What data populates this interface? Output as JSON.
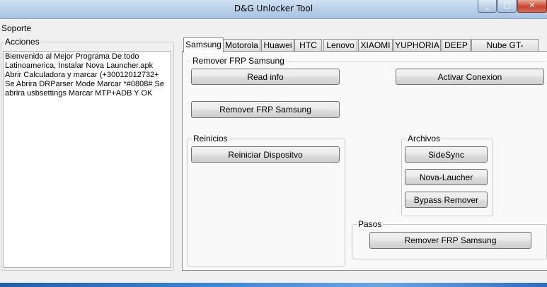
{
  "window": {
    "title": "D&G Unlocker Tool",
    "minimize": "_",
    "maximize": "□",
    "close": "✕"
  },
  "menu": {
    "items": [
      "Soporte"
    ]
  },
  "actions": {
    "label": "Acciones",
    "text": "Bienvenido al Mejor Programa De todo Latinoamerica, Instalar Nova Launcher.apk  Abrir Calculadora y marcar (+30012012732+  Se Abrira DRParser Mode Marcar *#0808# Se abrira usbsettings Marcar MTP+ADB Y OK"
  },
  "tabs": [
    "Samsung",
    "Motorola",
    "Huawei",
    "HTC",
    "Lenovo",
    "XIAOMI",
    "YUPHORIA",
    "DEEP",
    "Nube GT-SMART"
  ],
  "active_tab": "Samsung",
  "samsung": {
    "frp_group": {
      "label": "Remover FRP Samsung",
      "read_info": "Read info",
      "activar": "Activar Conexion",
      "remover": "Remover FRP Samsung"
    },
    "reinicios": {
      "label": "Reinicios",
      "reiniciar": "Reiniciar Dispositvo"
    },
    "archivos": {
      "label": "Archivos",
      "sidesync": "SideSync",
      "nova": "Nova-Laucher",
      "bypass": "Bypass Remover"
    },
    "pasos": {
      "label": "Pasos",
      "remover": "Remover FRP Samsung"
    }
  }
}
